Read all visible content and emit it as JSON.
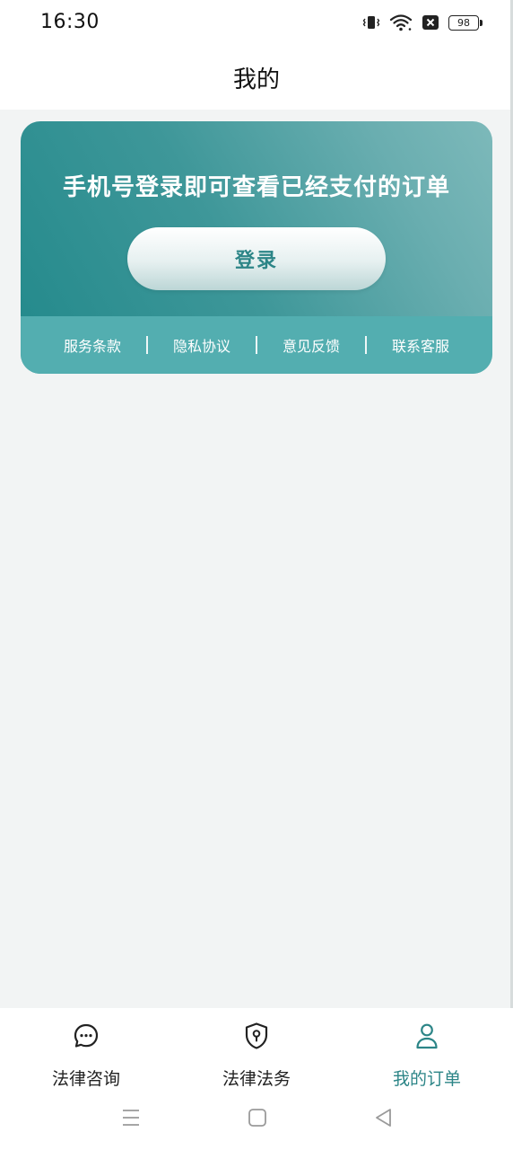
{
  "status_bar": {
    "time": "16:30",
    "battery": "98",
    "icons": [
      "vibrate-icon",
      "wifi-icon",
      "sim-off-icon",
      "battery-icon"
    ]
  },
  "header": {
    "title": "我的"
  },
  "login_card": {
    "headline": "手机号登录即可查看已经支付的订单",
    "login_button": "登录",
    "links": [
      "服务条款",
      "隐私协议",
      "意见反馈",
      "联系客服"
    ]
  },
  "bottom_nav": {
    "items": [
      {
        "label": "法律咨询",
        "icon": "chat-bubble-icon",
        "active": false
      },
      {
        "label": "法律法务",
        "icon": "shield-lock-icon",
        "active": false
      },
      {
        "label": "我的订单",
        "icon": "person-icon",
        "active": true
      }
    ]
  },
  "colors": {
    "accent": "#2c8587",
    "card_gradient_start": "#22898b",
    "card_gradient_end": "#7db9ba",
    "links_bar": "#53aeb0",
    "background": "#f2f4f4"
  },
  "system_nav": [
    "menu-icon",
    "home-icon",
    "back-icon"
  ]
}
